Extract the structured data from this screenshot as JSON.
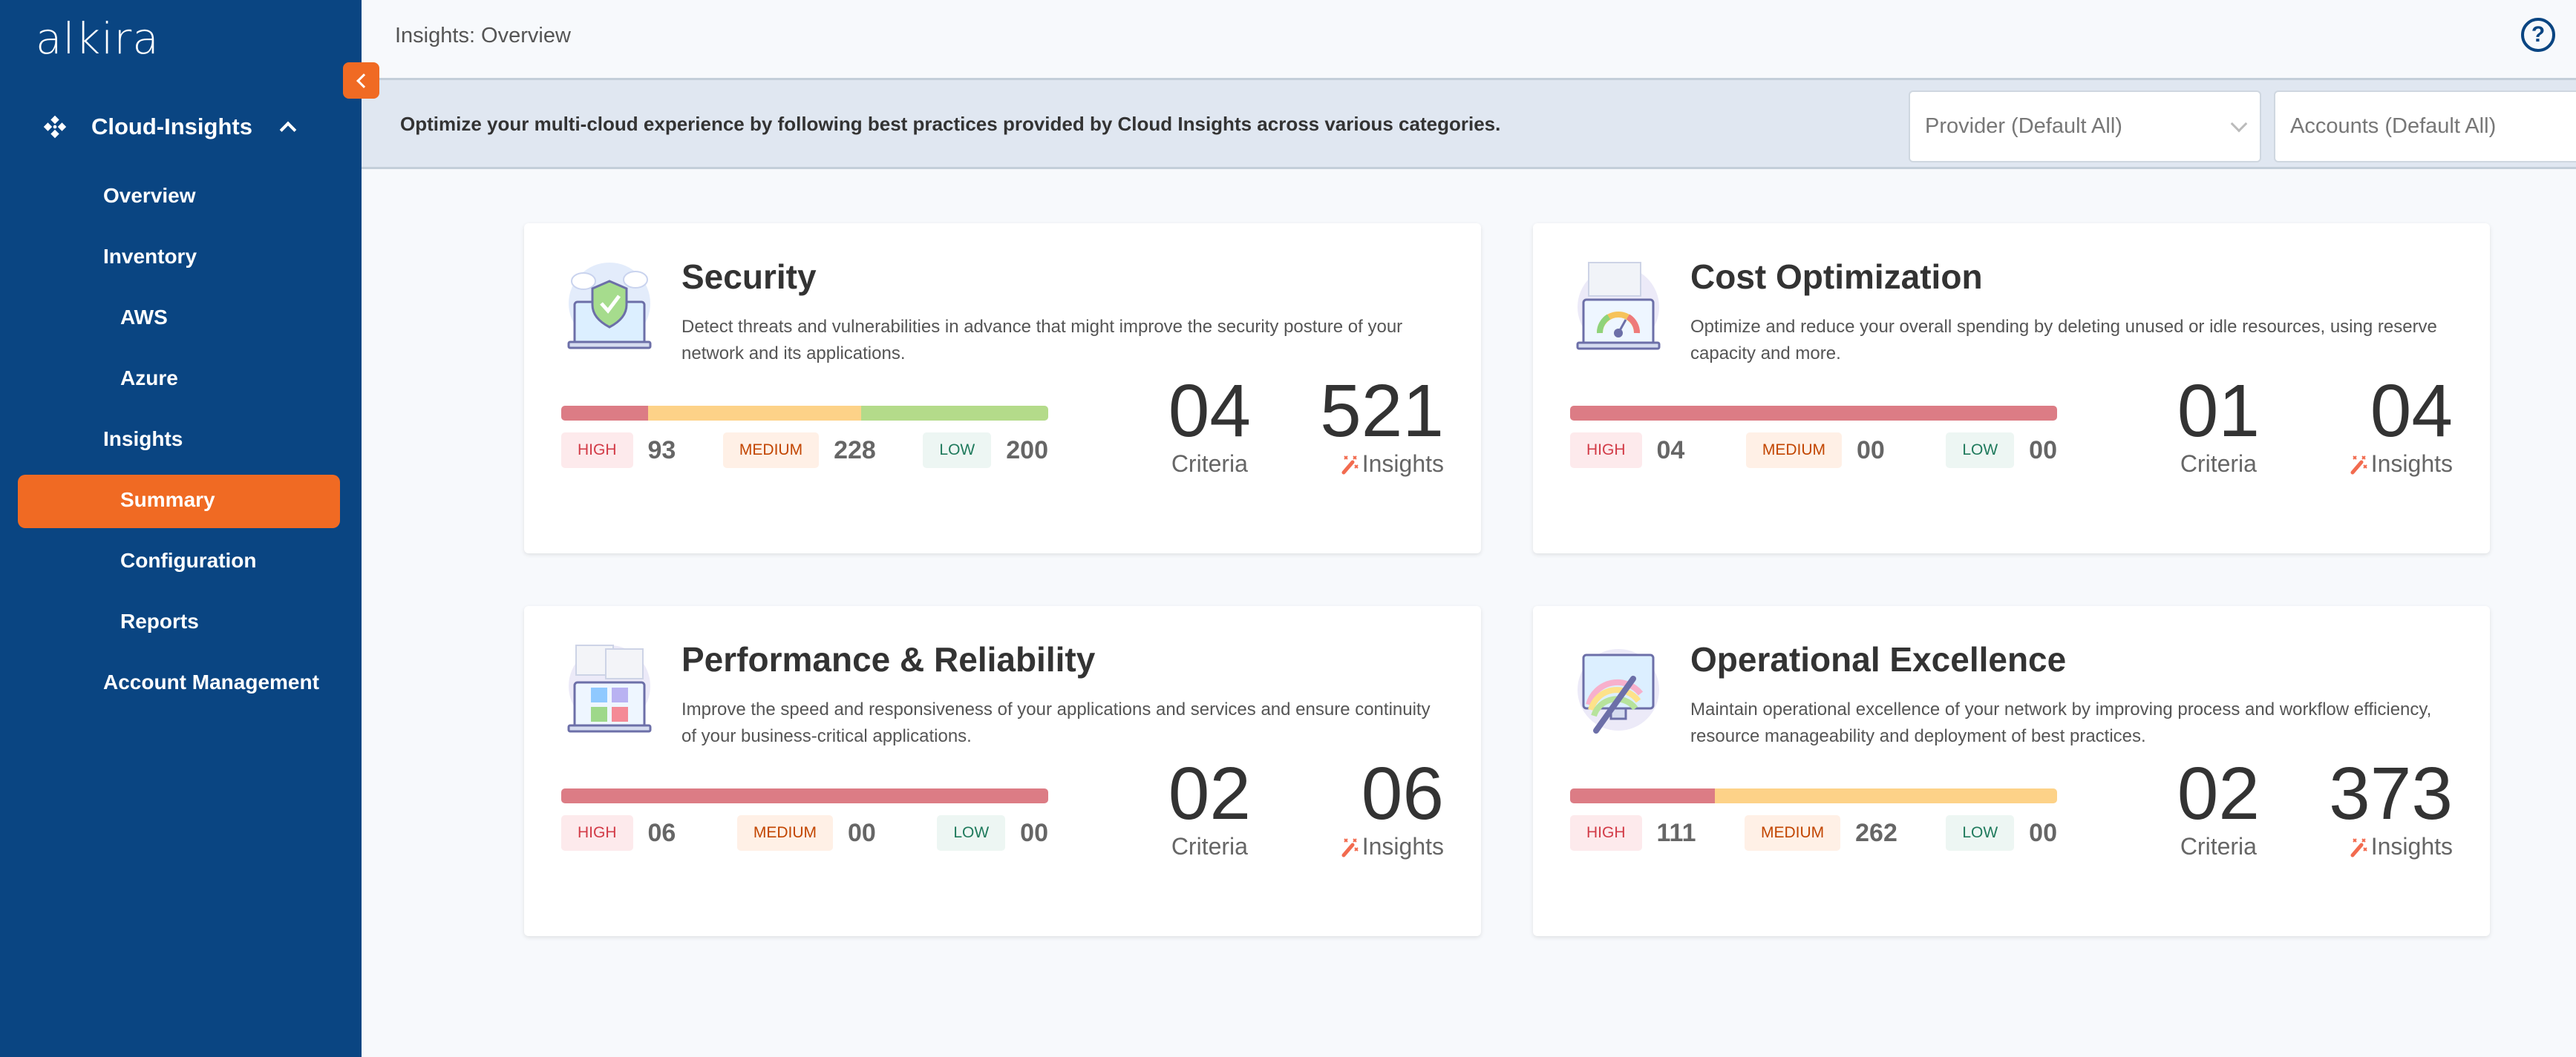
{
  "sidebar": {
    "logo": "alkira",
    "section": "Cloud-Insights",
    "items": [
      {
        "label": "Overview",
        "level": 1
      },
      {
        "label": "Inventory",
        "level": 1
      },
      {
        "label": "AWS",
        "level": 2
      },
      {
        "label": "Azure",
        "level": 2
      },
      {
        "label": "Insights",
        "level": 1
      },
      {
        "label": "Summary",
        "level": 2,
        "active": true
      },
      {
        "label": "Configuration",
        "level": 2
      },
      {
        "label": "Reports",
        "level": 2
      },
      {
        "label": "Account Management",
        "level": 1
      }
    ],
    "colors": {
      "background": "#0a4582",
      "active": "#f06a23"
    }
  },
  "header": {
    "title": "Insights: Overview",
    "help_icon": "help-circle-icon"
  },
  "banner": {
    "text": "Optimize your multi-cloud experience by following best practices provided by Cloud Insights across various categories.",
    "provider_placeholder": "Provider (Default All)",
    "accounts_placeholder": "Accounts (Default All)"
  },
  "labels": {
    "high": "HIGH",
    "medium": "MEDIUM",
    "low": "LOW",
    "criteria": "Criteria",
    "insights": "Insights"
  },
  "severity_colors": {
    "high": "#dc7c85",
    "medium": "#fdd288",
    "low": "#b4db8a"
  },
  "cards": [
    {
      "title": "Security",
      "icon": "security-shield-laptop-icon",
      "description": "Detect threats and vulnerabilities in advance that might improve the security posture of your network and its applications.",
      "high": "93",
      "medium": "228",
      "low": "200",
      "criteria": "04",
      "insights": "521"
    },
    {
      "title": "Cost Optimization",
      "icon": "cost-gauge-laptop-icon",
      "description": "Optimize and reduce your overall spending by deleting unused or idle resources, using reserve capacity and more.",
      "high": "04",
      "medium": "00",
      "low": "00",
      "criteria": "01",
      "insights": "04"
    },
    {
      "title": "Performance & Reliability",
      "icon": "performance-dashboard-laptop-icon",
      "description": "Improve the speed and responsiveness of your applications and services and ensure continuity of your business-critical applications.",
      "high": "06",
      "medium": "00",
      "low": "00",
      "criteria": "02",
      "insights": "06"
    },
    {
      "title": "Operational Excellence",
      "icon": "operational-monitor-pen-icon",
      "description": "Maintain operational excellence of your network by improving process and workflow efficiency, resource manageability and deployment of best practices.",
      "high": "111",
      "medium": "262",
      "low": "00",
      "criteria": "02",
      "insights": "373"
    }
  ]
}
